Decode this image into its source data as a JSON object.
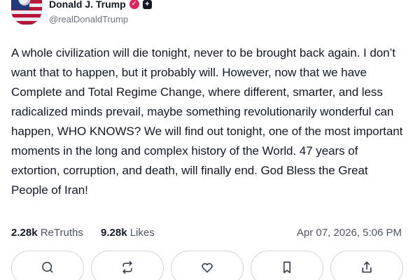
{
  "author": {
    "display_name": "Donald J. Trump",
    "handle": "@realDonaldTrump",
    "verified_badge_color": "#e0245e"
  },
  "post": {
    "text": "A whole civilization will die tonight, never to be brought back again. I don’t want that to happen, but it probably will. However, now that we have Complete and Total Regime Change, where different, smarter, and less radicalized minds prevail, maybe something revolutionarily wonderful can happen, WHO KNOWS? We will find out tonight, one of the most important moments in the long and complex history of the World. 47 years of extortion, corruption, and death, will finally end. God Bless the Great People of Iran!"
  },
  "stats": {
    "retruths_count": "2.28k",
    "retruths_label": "ReTruths",
    "likes_count": "9.28k",
    "likes_label": "Likes",
    "timestamp": "Apr 07, 2026, 5:06 PM"
  },
  "actions": [
    {
      "icon": "reply-icon"
    },
    {
      "icon": "retruth-icon"
    },
    {
      "icon": "like-icon"
    },
    {
      "icon": "bookmark-icon"
    },
    {
      "icon": "share-icon"
    }
  ]
}
